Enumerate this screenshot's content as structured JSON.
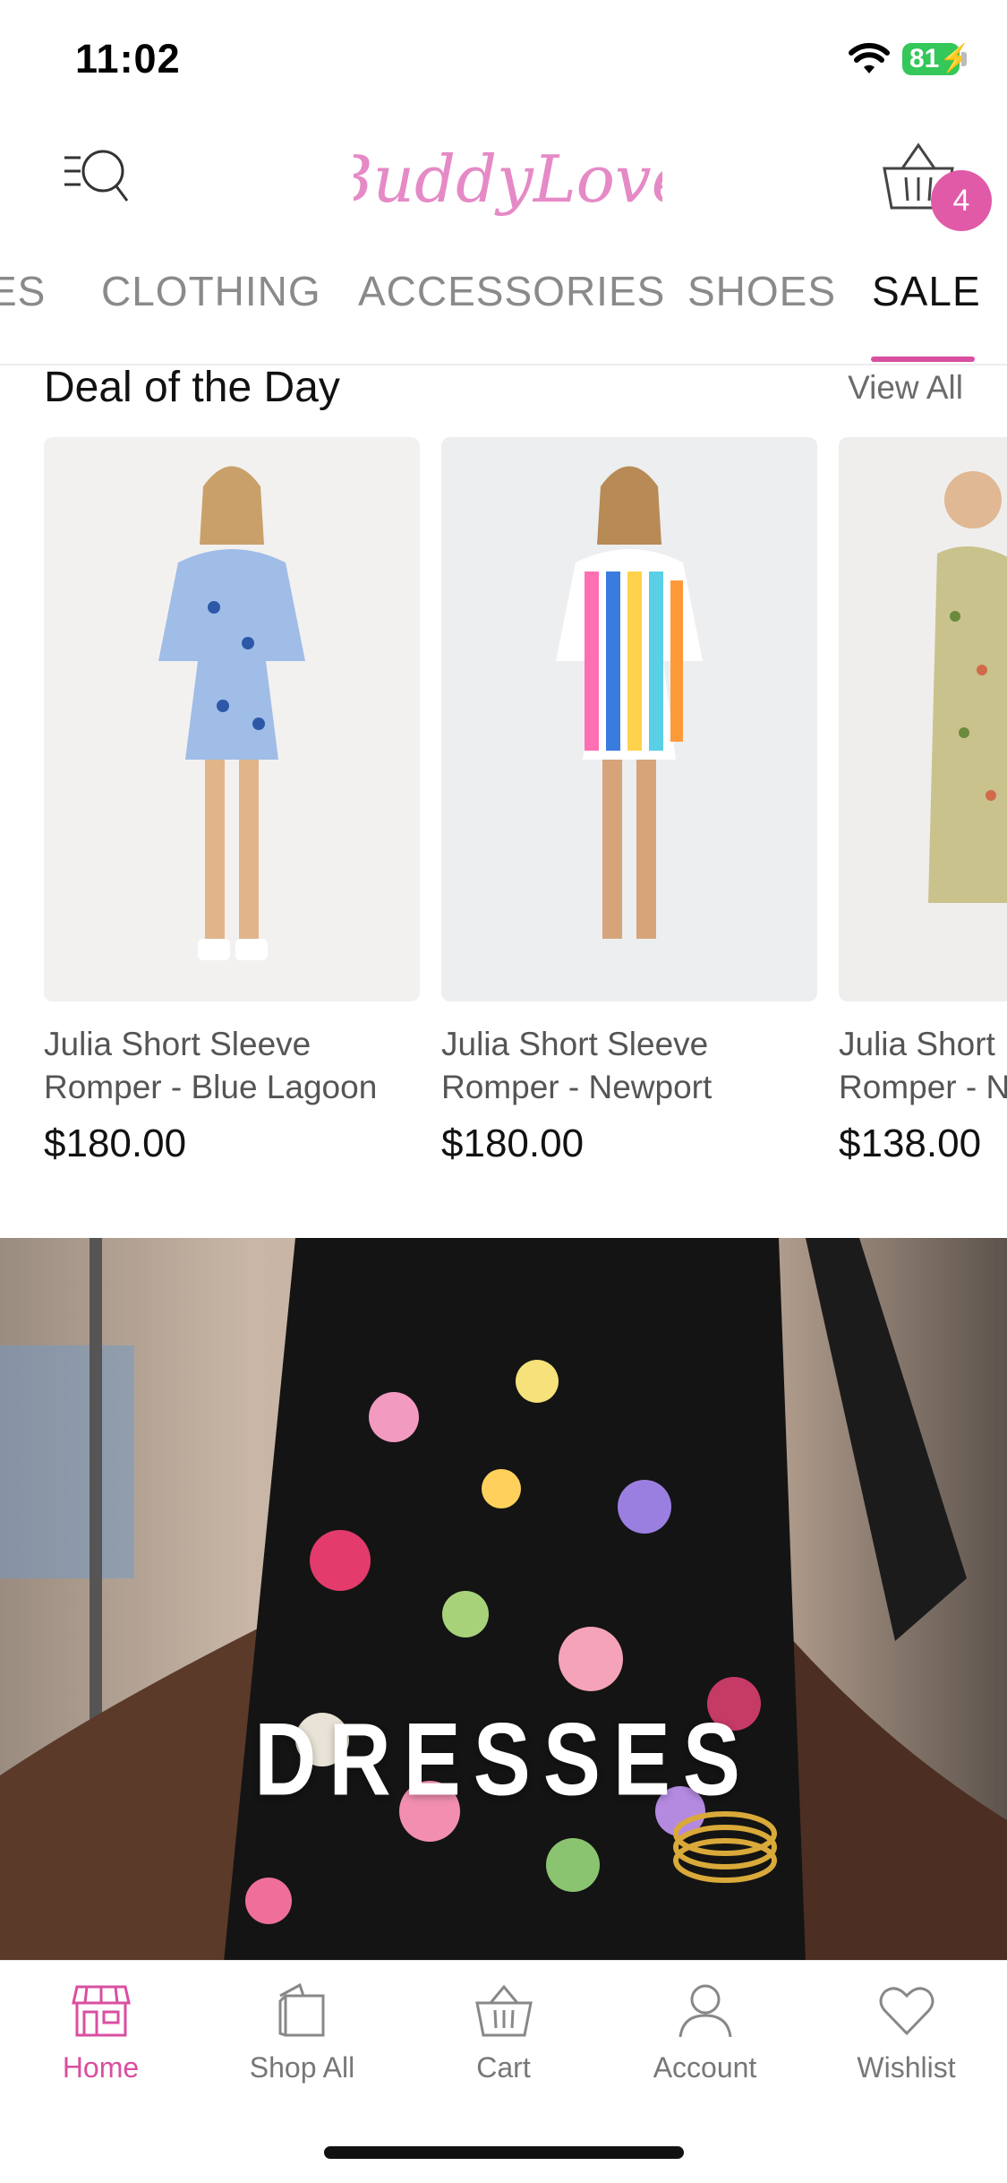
{
  "status_bar": {
    "time": "11:02",
    "battery": "81"
  },
  "header": {
    "brand": "BuddyLove",
    "cart_count": "4"
  },
  "tabs": [
    {
      "label": "ES"
    },
    {
      "label": "CLOTHING"
    },
    {
      "label": "ACCESSORIES"
    },
    {
      "label": "SHOES"
    },
    {
      "label": "SALE",
      "active": true
    }
  ],
  "deal_section": {
    "title": "Deal of the Day",
    "view_all": "View All"
  },
  "products": [
    {
      "name_line1": "Julia Short Sleeve",
      "name_line2": "Romper - Blue Lagoon",
      "price": "$180.00"
    },
    {
      "name_line1": "Julia Short Sleeve",
      "name_line2": "Romper - Newport",
      "price": "$180.00"
    },
    {
      "name_line1": "Julia Short",
      "name_line2": "Romper - N",
      "price": "$138.00"
    }
  ],
  "banner": {
    "title": "DRESSES"
  },
  "bottom_nav": [
    {
      "label": "Home",
      "icon": "storefront-icon",
      "active": true
    },
    {
      "label": "Shop All",
      "icon": "shopping-bag-icon"
    },
    {
      "label": "Cart",
      "icon": "basket-icon"
    },
    {
      "label": "Account",
      "icon": "person-icon"
    },
    {
      "label": "Wishlist",
      "icon": "heart-icon"
    }
  ],
  "colors": {
    "accent": "#d94fa0",
    "badge": "#e05aa8",
    "battery": "#34c759"
  }
}
